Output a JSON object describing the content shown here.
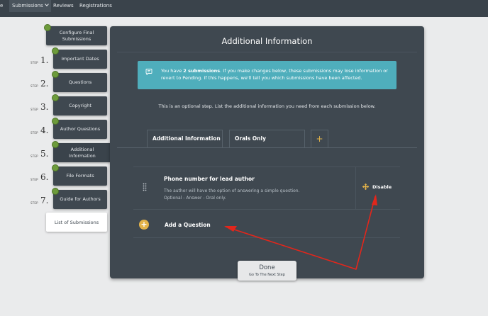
{
  "nav": {
    "items": [
      {
        "label": "e"
      },
      {
        "label": "Submissions"
      },
      {
        "label": "Reviews"
      },
      {
        "label": "Registrations"
      }
    ]
  },
  "steps": {
    "step_word": "STEP",
    "items": [
      {
        "label": "Configure Final Submissions",
        "num": ""
      },
      {
        "label": "Important Dates",
        "num": "1."
      },
      {
        "label": "Questions",
        "num": "2."
      },
      {
        "label": "Copyright",
        "num": "3."
      },
      {
        "label": "Author Questions",
        "num": "4."
      },
      {
        "label": "Additional Information",
        "num": "5."
      },
      {
        "label": "File Formats",
        "num": "6."
      },
      {
        "label": "Guide for Authors",
        "num": "7."
      }
    ],
    "list_submissions": "List of Submissions"
  },
  "panel": {
    "title": "Additional Information",
    "info": {
      "prefix": "You have ",
      "bold": "2 submissions",
      "suffix": ". If you make changes below, these submissions may lose information or revert to Pending. If this happens, we'll tell you which submissions have been affected."
    },
    "optional_text": "This is an optional step. List the additional information you need from each submission below.",
    "tabs": [
      {
        "label": "Additional Information"
      },
      {
        "label": "Orals Only"
      }
    ],
    "tab_add": "+",
    "question": {
      "title": "Phone number for lead author",
      "desc_line1": "The author will have the option of answering a simple question.",
      "desc_line2": "Optional - Answer - Oral only.",
      "disable_label": "Disable"
    },
    "add_question": {
      "icon": "+",
      "label": "Add a Question"
    }
  },
  "done": {
    "title": "Done",
    "subtitle": "Go To The Next Step"
  },
  "colors": {
    "accent_yellow": "#e3b34a",
    "info_teal": "#4faebc",
    "step_dot_green": "#6d9b3c",
    "annotation_red": "#e3261b",
    "panel_bg": "#3f4850"
  }
}
